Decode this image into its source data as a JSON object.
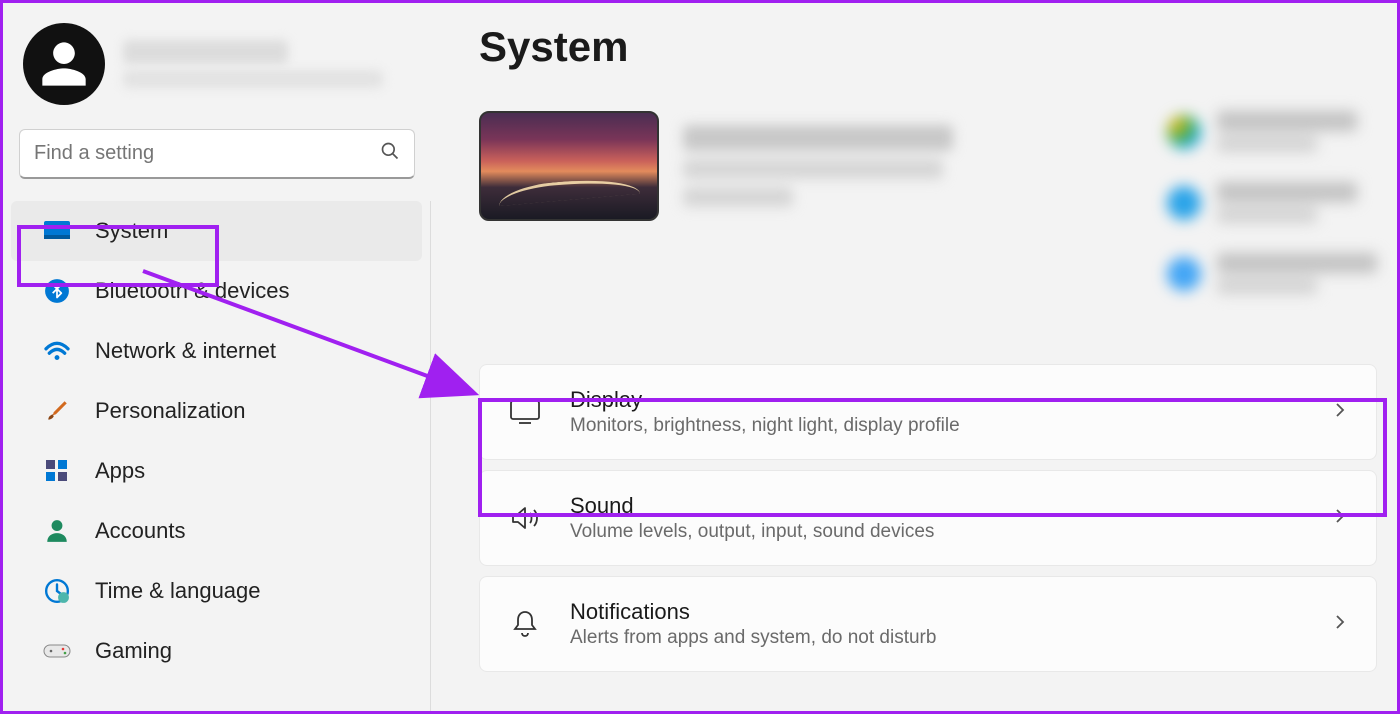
{
  "page_title": "System",
  "search_placeholder": "Find a setting",
  "sidebar": {
    "items": [
      {
        "label": "System",
        "icon": "system-icon",
        "active": true
      },
      {
        "label": "Bluetooth & devices",
        "icon": "bluetooth-icon",
        "active": false
      },
      {
        "label": "Network & internet",
        "icon": "wifi-icon",
        "active": false
      },
      {
        "label": "Personalization",
        "icon": "brush-icon",
        "active": false
      },
      {
        "label": "Apps",
        "icon": "apps-icon",
        "active": false
      },
      {
        "label": "Accounts",
        "icon": "account-icon",
        "active": false
      },
      {
        "label": "Time & language",
        "icon": "clock-globe-icon",
        "active": false
      },
      {
        "label": "Gaming",
        "icon": "gamepad-icon",
        "active": false
      }
    ]
  },
  "settings": [
    {
      "title": "Display",
      "subtitle": "Monitors, brightness, night light, display profile",
      "icon": "display-icon"
    },
    {
      "title": "Sound",
      "subtitle": "Volume levels, output, input, sound devices",
      "icon": "sound-icon"
    },
    {
      "title": "Notifications",
      "subtitle": "Alerts from apps and system, do not disturb",
      "icon": "bell-icon"
    }
  ],
  "annotation": {
    "highlight_color": "#a020f0"
  }
}
